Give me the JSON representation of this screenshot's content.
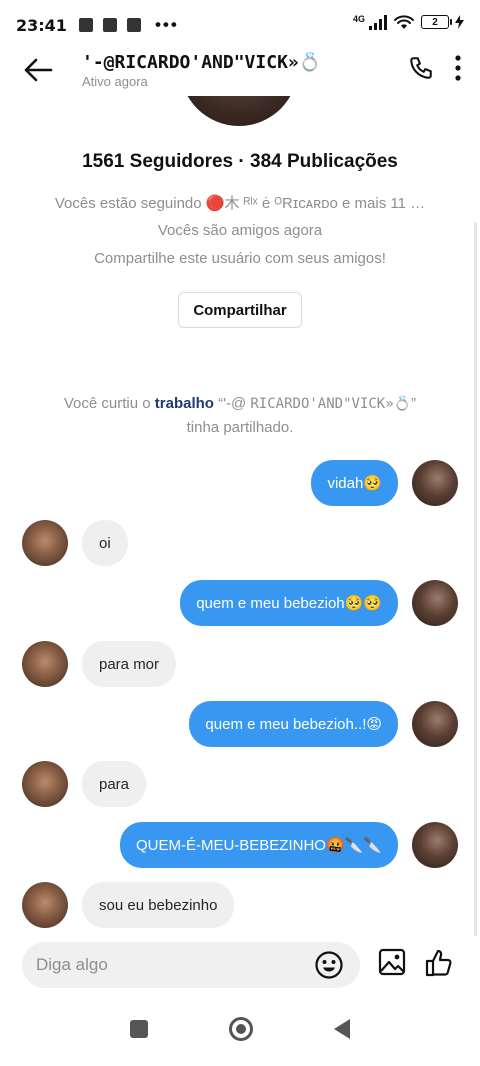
{
  "status_bar": {
    "time": "23:41",
    "dots": "•••",
    "network": "4G",
    "battery": "2"
  },
  "header": {
    "name": "'-@RICARDO'AND\"VICK»💍",
    "status": "Ativo agora"
  },
  "profile": {
    "stats": "1561 Seguidores · 384 Publicações",
    "following": "Vocês estão seguindo 🔴⃝木 ᴿˡˣ ė ᴼRɪᴄᴀʀᴅᴏ e mais 11 …",
    "friends": "Vocês são amigos agora",
    "share_prompt": "Compartilhe este usuário com seus amigos!",
    "share_button": "Compartilhar"
  },
  "notice": {
    "prefix": "Você curtiu o ",
    "link": "trabalho",
    "quote_open": " “'-@",
    "name": "RICARDO'AND\"VICK»💍",
    "suffix": "” tinha partilhado."
  },
  "messages": [
    {
      "side": "out",
      "text": "vidah🥺"
    },
    {
      "side": "in",
      "text": "oi"
    },
    {
      "side": "out",
      "text": "quem e meu bebezioh🥺🥺"
    },
    {
      "side": "in",
      "text": "para mor"
    },
    {
      "side": "out",
      "text": "quem e meu bebezioh..!😡"
    },
    {
      "side": "in",
      "text": "para"
    },
    {
      "side": "out",
      "text": "QUEM-É-MEU-BEBEZINHO🤬🔪🔪"
    },
    {
      "side": "in",
      "text": "sou eu bebezinho"
    }
  ],
  "composer": {
    "placeholder": "Diga algo"
  },
  "icons": {
    "back": "arrow-left-icon",
    "call": "phone-icon",
    "menu": "kebab-menu-icon",
    "emoji": "emoji-icon",
    "gallery": "image-icon",
    "like": "thumbs-up-icon"
  },
  "colors": {
    "outgoing_bubble": "#3897f0",
    "incoming_bubble": "#efefef",
    "link": "#1f3b73"
  }
}
